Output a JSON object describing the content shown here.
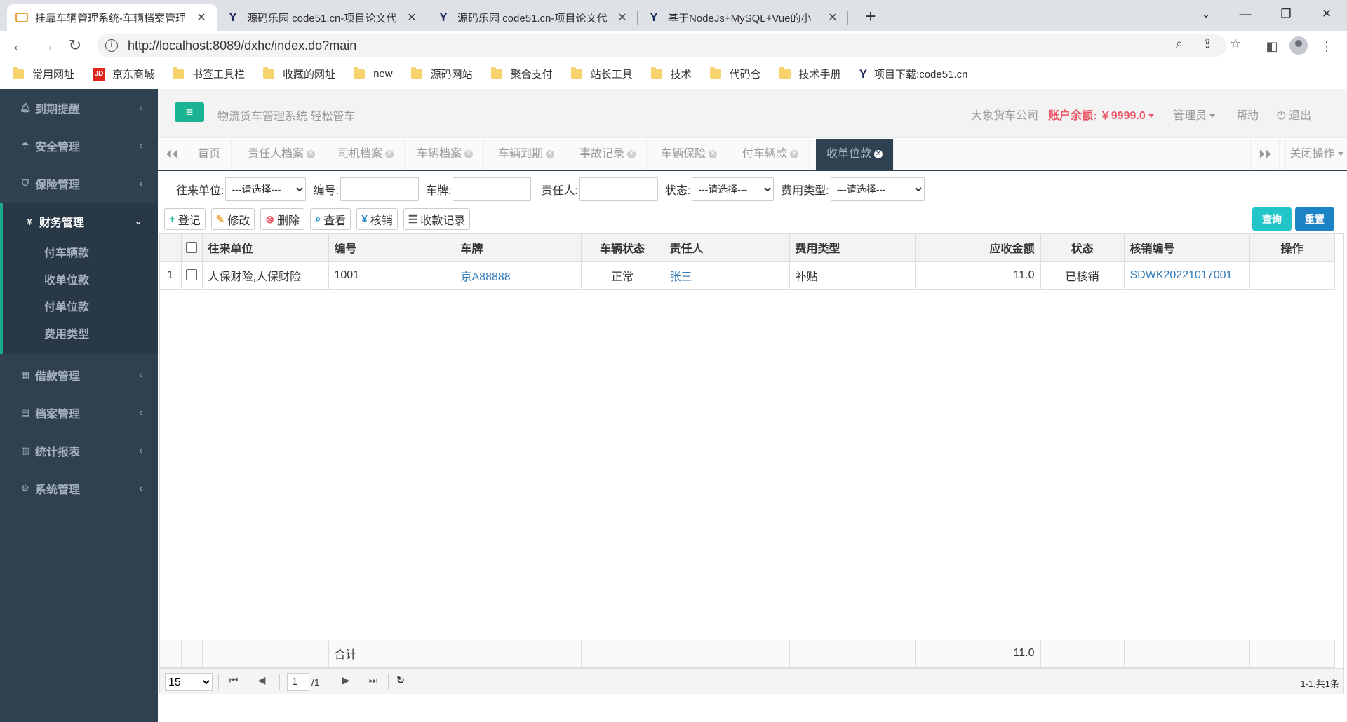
{
  "browser": {
    "tabs": [
      {
        "title": "挂靠车辆管理系统-车辆档案管理",
        "icon": "app-icon",
        "active": true
      },
      {
        "title": "源码乐园 code51.cn-项目论文代",
        "icon": "y-logo-icon"
      },
      {
        "title": "源码乐园 code51.cn-项目论文代",
        "icon": "y-logo-icon"
      },
      {
        "title": "基于NodeJs+MySQL+Vue的小",
        "icon": "y-logo-icon"
      }
    ],
    "url": "http://localhost:8089/dxhc/index.do?main",
    "bookmarks": [
      {
        "label": "常用网址",
        "icon": "folder-icon"
      },
      {
        "label": "京东商城",
        "icon": "jd-icon"
      },
      {
        "label": "书签工具栏",
        "icon": "folder-icon"
      },
      {
        "label": "收藏的网址",
        "icon": "folder-icon"
      },
      {
        "label": "new",
        "icon": "folder-icon"
      },
      {
        "label": "源码网站",
        "icon": "folder-icon"
      },
      {
        "label": "聚合支付",
        "icon": "folder-icon"
      },
      {
        "label": "站长工具",
        "icon": "folder-icon"
      },
      {
        "label": "技术",
        "icon": "folder-icon"
      },
      {
        "label": "代码仓",
        "icon": "folder-icon"
      },
      {
        "label": "技术手册",
        "icon": "folder-icon"
      },
      {
        "label": "项目下载:code51.cn",
        "icon": "y-logo-icon"
      }
    ]
  },
  "sidebar": {
    "menus": [
      {
        "label": "到期提醒",
        "icon": "bell-icon"
      },
      {
        "label": "安全管理",
        "icon": "umbrella-icon"
      },
      {
        "label": "保险管理",
        "icon": "shield-icon"
      },
      {
        "label": "财务管理",
        "icon": "yen-icon"
      },
      {
        "label": "借款管理",
        "icon": "calculator-icon"
      },
      {
        "label": "档案管理",
        "icon": "file-icon"
      },
      {
        "label": "统计报表",
        "icon": "bar-chart-icon"
      },
      {
        "label": "系统管理",
        "icon": "gear-icon"
      }
    ],
    "finance_sub": [
      "付车辆款",
      "收单位款",
      "付单位款",
      "费用类型"
    ]
  },
  "header": {
    "system_name": "物流货车管理系统 轻松管车",
    "company": "大象货车公司",
    "balance": "账户余额: ￥9999.0",
    "user": "管理员",
    "help": "帮助",
    "logout": "退出"
  },
  "content_tabs": [
    "首页",
    "责任人档案",
    "司机档案",
    "车辆档案",
    "车辆到期",
    "事故记录",
    "车辆保险",
    "付车辆款",
    "收单位款"
  ],
  "content_tabs_close": "关闭操作",
  "filter": {
    "unit_label": "往来单位:",
    "unit_value": "---请选择---",
    "code_label": "编号:",
    "plate_label": "车牌:",
    "owner_label": "责任人:",
    "status_label": "状态:",
    "status_value": "---请选择---",
    "fee_label": "费用类型:",
    "fee_value": "---请选择---"
  },
  "toolbar": {
    "register": "登记",
    "edit": "修改",
    "delete": "删除",
    "view": "查看",
    "verify": "核销",
    "records": "收款记录",
    "search": "查询",
    "reset": "重置"
  },
  "table": {
    "columns": [
      "往来单位",
      "编号",
      "车牌",
      "车辆状态",
      "责任人",
      "费用类型",
      "应收金额",
      "状态",
      "核销编号",
      "操作"
    ],
    "rows": [
      {
        "no": "1",
        "unit": "人保财险,人保财险",
        "code": "1001",
        "plate": "京A88888",
        "vstatus": "正常",
        "owner": "张三",
        "fee": "补贴",
        "amount": "11.0",
        "status": "已核销",
        "verify_no": "SDWK20221017001",
        "op": ""
      }
    ],
    "footer": {
      "label": "合计",
      "amount": "11.0"
    }
  },
  "pager": {
    "page_size": "15",
    "page": "1",
    "total_pages": "/1",
    "info": "1-1,共1条"
  }
}
